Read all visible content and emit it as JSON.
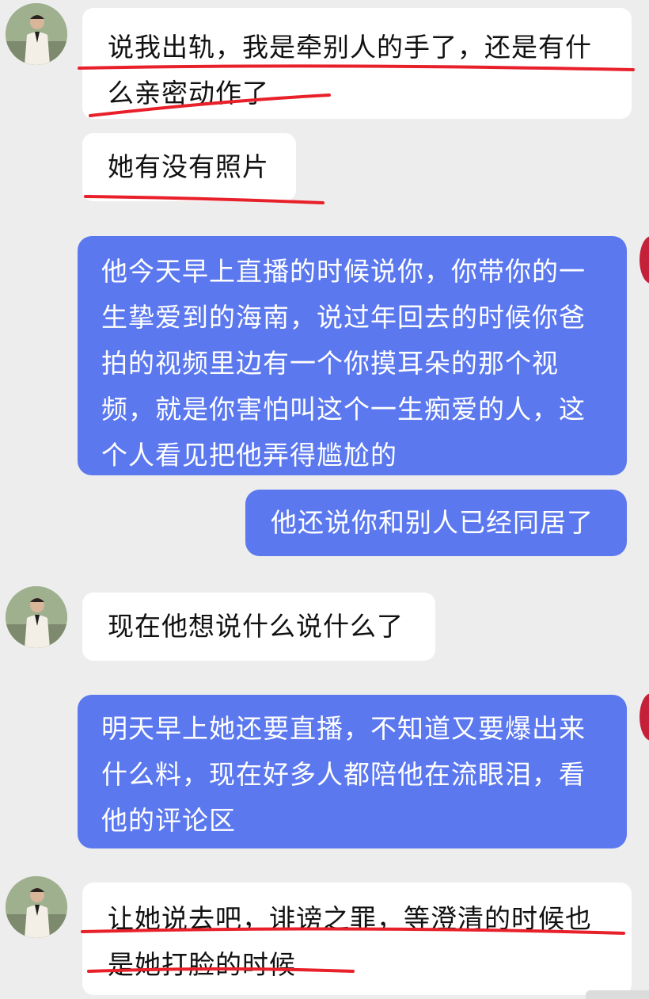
{
  "messages": [
    {
      "side": "in",
      "text": "说我出轨，我是牵别人的手了，还是有什\n么亲密动作了"
    },
    {
      "side": "in",
      "text": "她有没有照片"
    },
    {
      "side": "out",
      "text": "他今天早上直播的时候说你，你带你的一\n生挚爱到的海南，说过年回去的时候你爸\n拍的视频里边有一个你摸耳朵的那个视\n频，就是你害怕叫这个一生痴爱的人，这\n个人看见把他弄得尴尬的"
    },
    {
      "side": "out",
      "text": "他还说你和别人已经同居了"
    },
    {
      "side": "in",
      "text": "现在他想说什么说什么了"
    },
    {
      "side": "out",
      "text": "明天早上她还要直播，不知道又要爆出来\n什么料，现在好多人都陪他在流眼泪，看\n他的评论区"
    },
    {
      "side": "in",
      "text": "让她说去吧，诽谤之罪，等澄清的时候也\n是她打脸的时候"
    }
  ],
  "colors": {
    "incoming_bubble": "#ffffff",
    "outgoing_bubble": "#5b78ef",
    "underline": "#e8202a",
    "background": "#ededed"
  }
}
